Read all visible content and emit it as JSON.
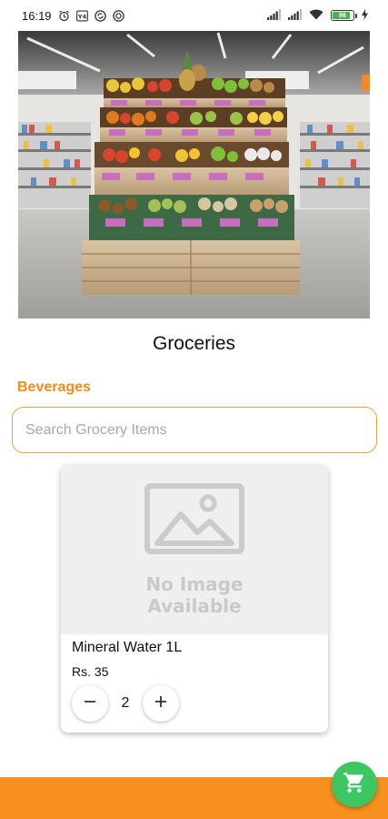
{
  "status_bar": {
    "time": "16:19",
    "left_icons": [
      "alarm-icon",
      "sim-icon",
      "sync-icon",
      "data-saver-icon"
    ],
    "right_icons": [
      "signal-icon",
      "signal-icon",
      "wifi-icon",
      "battery-icon",
      "charging-icon"
    ],
    "battery_level": "86",
    "battery_color": "#4caf50"
  },
  "hero": {
    "image_desc_icon": "groceries-shelf-image"
  },
  "page": {
    "title": "Groceries"
  },
  "category": {
    "label": "Beverages",
    "color": "#f28c1b"
  },
  "search": {
    "placeholder": "Search Grocery Items",
    "value": "",
    "border_color": "#f0a23a"
  },
  "products": [
    {
      "name": "Mineral Water 1L",
      "price": "Rs. 35",
      "quantity": "2",
      "image_text_line1": "No Image",
      "image_text_line2": "Available",
      "decrement_icon": "minus-icon",
      "increment_icon": "plus-icon"
    }
  ],
  "bottom_bar": {
    "color": "#f7901e"
  },
  "cart_fab": {
    "icon": "cart-icon",
    "color": "#3cc763"
  }
}
